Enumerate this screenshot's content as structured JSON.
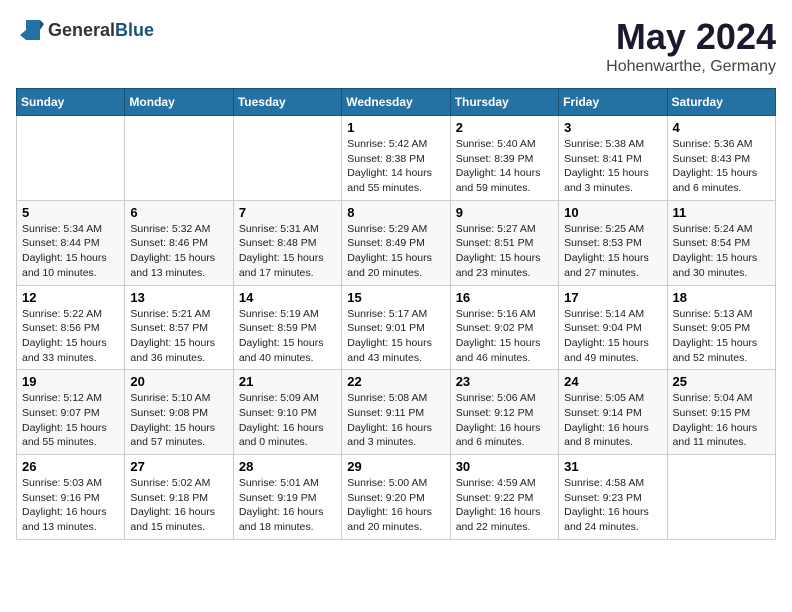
{
  "logo": {
    "text_general": "General",
    "text_blue": "Blue"
  },
  "title": "May 2024",
  "subtitle": "Hohenwarthe, Germany",
  "days_of_week": [
    "Sunday",
    "Monday",
    "Tuesday",
    "Wednesday",
    "Thursday",
    "Friday",
    "Saturday"
  ],
  "weeks": [
    [
      {
        "day": "",
        "info": ""
      },
      {
        "day": "",
        "info": ""
      },
      {
        "day": "",
        "info": ""
      },
      {
        "day": "1",
        "info": "Sunrise: 5:42 AM\nSunset: 8:38 PM\nDaylight: 14 hours\nand 55 minutes."
      },
      {
        "day": "2",
        "info": "Sunrise: 5:40 AM\nSunset: 8:39 PM\nDaylight: 14 hours\nand 59 minutes."
      },
      {
        "day": "3",
        "info": "Sunrise: 5:38 AM\nSunset: 8:41 PM\nDaylight: 15 hours\nand 3 minutes."
      },
      {
        "day": "4",
        "info": "Sunrise: 5:36 AM\nSunset: 8:43 PM\nDaylight: 15 hours\nand 6 minutes."
      }
    ],
    [
      {
        "day": "5",
        "info": "Sunrise: 5:34 AM\nSunset: 8:44 PM\nDaylight: 15 hours\nand 10 minutes."
      },
      {
        "day": "6",
        "info": "Sunrise: 5:32 AM\nSunset: 8:46 PM\nDaylight: 15 hours\nand 13 minutes."
      },
      {
        "day": "7",
        "info": "Sunrise: 5:31 AM\nSunset: 8:48 PM\nDaylight: 15 hours\nand 17 minutes."
      },
      {
        "day": "8",
        "info": "Sunrise: 5:29 AM\nSunset: 8:49 PM\nDaylight: 15 hours\nand 20 minutes."
      },
      {
        "day": "9",
        "info": "Sunrise: 5:27 AM\nSunset: 8:51 PM\nDaylight: 15 hours\nand 23 minutes."
      },
      {
        "day": "10",
        "info": "Sunrise: 5:25 AM\nSunset: 8:53 PM\nDaylight: 15 hours\nand 27 minutes."
      },
      {
        "day": "11",
        "info": "Sunrise: 5:24 AM\nSunset: 8:54 PM\nDaylight: 15 hours\nand 30 minutes."
      }
    ],
    [
      {
        "day": "12",
        "info": "Sunrise: 5:22 AM\nSunset: 8:56 PM\nDaylight: 15 hours\nand 33 minutes."
      },
      {
        "day": "13",
        "info": "Sunrise: 5:21 AM\nSunset: 8:57 PM\nDaylight: 15 hours\nand 36 minutes."
      },
      {
        "day": "14",
        "info": "Sunrise: 5:19 AM\nSunset: 8:59 PM\nDaylight: 15 hours\nand 40 minutes."
      },
      {
        "day": "15",
        "info": "Sunrise: 5:17 AM\nSunset: 9:01 PM\nDaylight: 15 hours\nand 43 minutes."
      },
      {
        "day": "16",
        "info": "Sunrise: 5:16 AM\nSunset: 9:02 PM\nDaylight: 15 hours\nand 46 minutes."
      },
      {
        "day": "17",
        "info": "Sunrise: 5:14 AM\nSunset: 9:04 PM\nDaylight: 15 hours\nand 49 minutes."
      },
      {
        "day": "18",
        "info": "Sunrise: 5:13 AM\nSunset: 9:05 PM\nDaylight: 15 hours\nand 52 minutes."
      }
    ],
    [
      {
        "day": "19",
        "info": "Sunrise: 5:12 AM\nSunset: 9:07 PM\nDaylight: 15 hours\nand 55 minutes."
      },
      {
        "day": "20",
        "info": "Sunrise: 5:10 AM\nSunset: 9:08 PM\nDaylight: 15 hours\nand 57 minutes."
      },
      {
        "day": "21",
        "info": "Sunrise: 5:09 AM\nSunset: 9:10 PM\nDaylight: 16 hours\nand 0 minutes."
      },
      {
        "day": "22",
        "info": "Sunrise: 5:08 AM\nSunset: 9:11 PM\nDaylight: 16 hours\nand 3 minutes."
      },
      {
        "day": "23",
        "info": "Sunrise: 5:06 AM\nSunset: 9:12 PM\nDaylight: 16 hours\nand 6 minutes."
      },
      {
        "day": "24",
        "info": "Sunrise: 5:05 AM\nSunset: 9:14 PM\nDaylight: 16 hours\nand 8 minutes."
      },
      {
        "day": "25",
        "info": "Sunrise: 5:04 AM\nSunset: 9:15 PM\nDaylight: 16 hours\nand 11 minutes."
      }
    ],
    [
      {
        "day": "26",
        "info": "Sunrise: 5:03 AM\nSunset: 9:16 PM\nDaylight: 16 hours\nand 13 minutes."
      },
      {
        "day": "27",
        "info": "Sunrise: 5:02 AM\nSunset: 9:18 PM\nDaylight: 16 hours\nand 15 minutes."
      },
      {
        "day": "28",
        "info": "Sunrise: 5:01 AM\nSunset: 9:19 PM\nDaylight: 16 hours\nand 18 minutes."
      },
      {
        "day": "29",
        "info": "Sunrise: 5:00 AM\nSunset: 9:20 PM\nDaylight: 16 hours\nand 20 minutes."
      },
      {
        "day": "30",
        "info": "Sunrise: 4:59 AM\nSunset: 9:22 PM\nDaylight: 16 hours\nand 22 minutes."
      },
      {
        "day": "31",
        "info": "Sunrise: 4:58 AM\nSunset: 9:23 PM\nDaylight: 16 hours\nand 24 minutes."
      },
      {
        "day": "",
        "info": ""
      }
    ]
  ]
}
